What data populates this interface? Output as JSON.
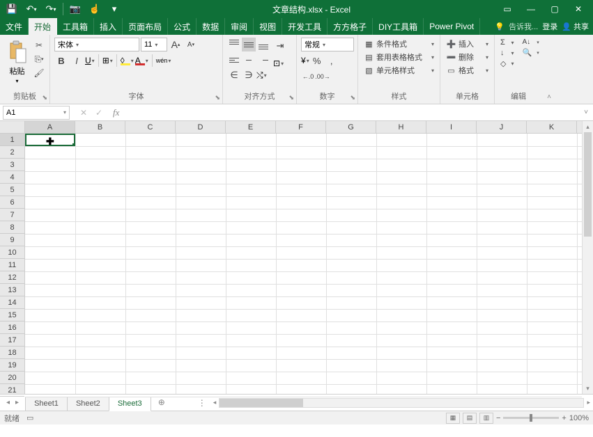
{
  "title": "文章结构.xlsx - Excel",
  "qat": {
    "save": "💾",
    "undo": "↶",
    "redo": "↷",
    "camera": "📷",
    "touch": "☝",
    "customize": "▾"
  },
  "winctrl": {
    "ribbon_opts": "▭",
    "min": "—",
    "max": "▢",
    "close": "✕"
  },
  "tabs": [
    "文件",
    "开始",
    "工具箱",
    "插入",
    "页面布局",
    "公式",
    "数据",
    "审阅",
    "视图",
    "开发工具",
    "方方格子",
    "DIY工具箱",
    "Power Pivot"
  ],
  "tab_help": {
    "tell_me": "告诉我...",
    "login": "登录",
    "share": "共享"
  },
  "ribbon": {
    "clipboard": {
      "paste": "粘贴",
      "cut": "✂",
      "copy": "⎘",
      "painter": "🖌",
      "label": "剪贴板"
    },
    "font": {
      "name": "宋体",
      "size": "11",
      "grow": "A",
      "shrink": "A",
      "bold": "B",
      "italic": "I",
      "underline": "U",
      "border": "⊞",
      "fill": "◊",
      "fontcolor": "A",
      "pinyin": "wén",
      "label": "字体"
    },
    "align": {
      "wrap": "⇥",
      "merge": "⊡",
      "label": "对齐方式"
    },
    "number": {
      "format": "常规",
      "currency": "¥",
      "percent": "%",
      "comma": ",",
      "inc_dec": "←.0",
      "dec_dec": ".00→",
      "label": "数字"
    },
    "styles": {
      "cond": "条件格式",
      "table": "套用表格格式",
      "cell": "单元格样式",
      "label": "样式"
    },
    "cells": {
      "insert": "插入",
      "delete": "删除",
      "format": "格式",
      "label": "单元格"
    },
    "edit": {
      "sum": "Σ",
      "fill": "↓",
      "clear": "◇",
      "sort": "A↓",
      "find": "🔍",
      "label": "编辑"
    }
  },
  "namebox": "A1",
  "columns": [
    "A",
    "B",
    "C",
    "D",
    "E",
    "F",
    "G",
    "H",
    "I",
    "J",
    "K"
  ],
  "rows": [
    "1",
    "2",
    "3",
    "4",
    "5",
    "6",
    "7",
    "8",
    "9",
    "10",
    "11",
    "12",
    "13",
    "14",
    "15",
    "16",
    "17",
    "18",
    "19",
    "20",
    "21"
  ],
  "sheets": [
    "Sheet1",
    "Sheet2",
    "Sheet3"
  ],
  "active_sheet": 2,
  "status": {
    "ready": "就绪",
    "rec": "▭",
    "zoom": "100%"
  }
}
